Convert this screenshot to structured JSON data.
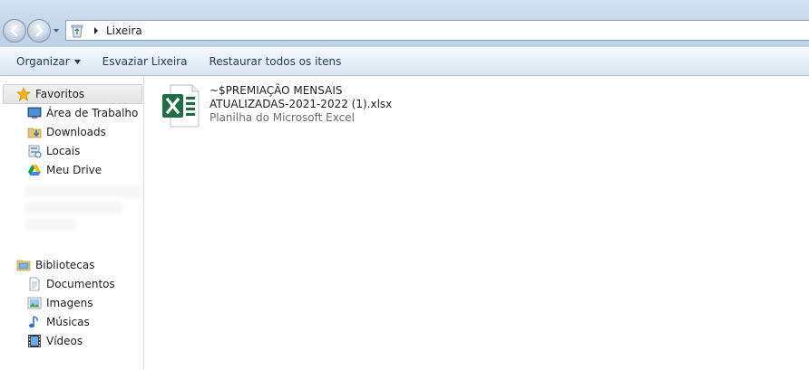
{
  "window": {
    "address": {
      "crumb": "Lixeira"
    }
  },
  "commandbar": {
    "organizar_label": "Organizar",
    "esvaziar_label": "Esvaziar Lixeira",
    "restaurar_label": "Restaurar todos os itens"
  },
  "navpane": {
    "favoritos": {
      "label": "Favoritos",
      "items": [
        {
          "label": "Área de Trabalho",
          "icon": "desktop-icon"
        },
        {
          "label": "Downloads",
          "icon": "downloads-icon"
        },
        {
          "label": "Locais",
          "icon": "recent-places-icon"
        },
        {
          "label": "Meu Drive",
          "icon": "google-drive-icon"
        }
      ]
    },
    "bibliotecas": {
      "label": "Bibliotecas",
      "items": [
        {
          "label": "Documentos",
          "icon": "documents-icon"
        },
        {
          "label": "Imagens",
          "icon": "pictures-icon"
        },
        {
          "label": "Músicas",
          "icon": "music-icon"
        },
        {
          "label": "Vídeos",
          "icon": "videos-icon"
        }
      ]
    }
  },
  "content": {
    "files": [
      {
        "name_line1": "~$PREMIAÇÃO MENSAIS",
        "name_line2": "ATUALIZADAS-2021-2022 (1).xlsx",
        "type": "Planilha do Microsoft Excel",
        "icon": "excel-file-icon"
      }
    ]
  },
  "colors": {
    "excel_green": "#1d6f42",
    "favorites_star": "#f5b800",
    "commandbar_text": "#1e3a5f"
  }
}
